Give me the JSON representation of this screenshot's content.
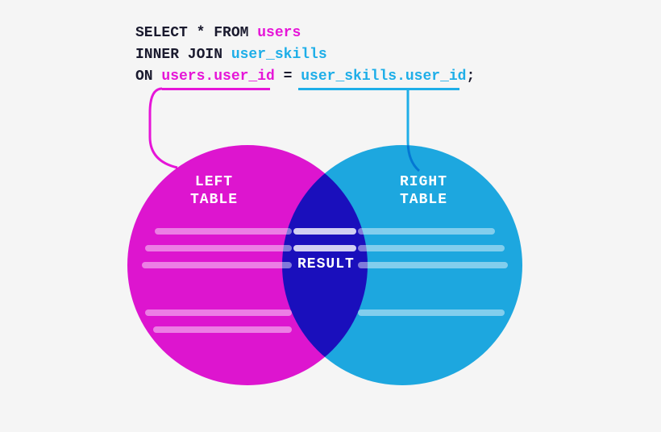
{
  "code": {
    "line1_kw1": "SELECT",
    "line1_star": " * ",
    "line1_kw2": "FROM ",
    "line1_users": "users",
    "line2_kw": "INNER JOIN ",
    "line2_skills": "user_skills",
    "line3_kw": "ON ",
    "line3_left": "users.user_id",
    "line3_eq": " = ",
    "line3_right": "user_skills.user_id",
    "line3_semi": ";"
  },
  "labels": {
    "left_top": "LEFT",
    "left_bottom": "TABLE",
    "right_top": "RIGHT",
    "right_bottom": "TABLE",
    "result": "RESULT"
  },
  "colors": {
    "left": "#e615d8",
    "right": "#1eaee8",
    "bg": "#f5f5f5"
  }
}
